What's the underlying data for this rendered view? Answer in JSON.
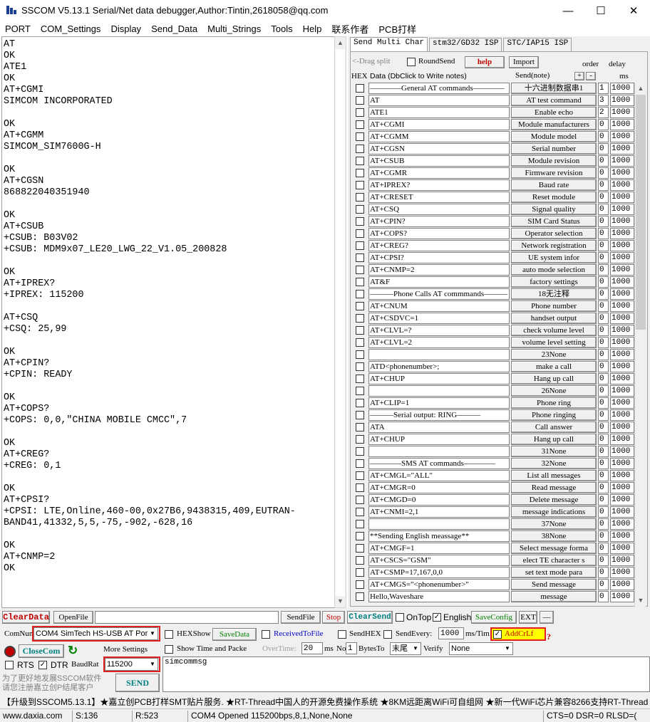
{
  "window": {
    "title": "SSCOM V5.13.1 Serial/Net data debugger,Author:Tintin,2618058@qq.com",
    "minimize": "—",
    "maximize": "☐",
    "close": "✕"
  },
  "menu": [
    "PORT",
    "COM_Settings",
    "Display",
    "Send_Data",
    "Multi_Strings",
    "Tools",
    "Help",
    "联系作者",
    "PCB打样"
  ],
  "receive_lines": [
    "AT",
    "OK",
    "ATE1",
    "OK",
    "AT+CGMI",
    "SIMCOM INCORPORATED",
    "",
    "OK",
    "AT+CGMM",
    "SIMCOM_SIM7600G-H",
    "",
    "OK",
    "AT+CGSN",
    "868822040351940",
    "",
    "OK",
    "AT+CSUB",
    "+CSUB: B03V02",
    "+CSUB: MDM9x07_LE20_LWG_22_V1.05_200828",
    "",
    "OK",
    "AT+IPREX?",
    "+IPREX: 115200",
    "",
    "AT+CSQ",
    "+CSQ: 25,99",
    "",
    "OK",
    "AT+CPIN?",
    "+CPIN: READY",
    "",
    "OK",
    "AT+COPS?",
    "+COPS: 0,0,\"CHINA MOBILE CMCC\",7",
    "",
    "OK",
    "AT+CREG?",
    "+CREG: 0,1",
    "",
    "OK",
    "AT+CPSI?",
    "+CPSI: LTE,Online,460-00,0x27B6,9438315,409,EUTRAN-",
    "BAND41,41332,5,5,-75,-902,-628,16",
    "",
    "OK",
    "AT+CNMP=2",
    "OK"
  ],
  "tabs": [
    "Send Multi Char",
    "stm32/GD32 ISP",
    "STC/IAP15 ISP"
  ],
  "multi": {
    "drag_split": "<-Drag split",
    "round_send": "RoundSend",
    "help": "help",
    "import": "Import",
    "order": "order",
    "delay": "delay",
    "hex": "HEX",
    "data_header": "Data (DbClick to Write notes)",
    "send_note": "Send(note)",
    "plus": "+",
    "minus": "-",
    "ms": "ms",
    "rows": [
      {
        "data": "————General AT commands————",
        "note": "十六进制数据串1",
        "order": "1",
        "delay": "1000"
      },
      {
        "data": "AT",
        "note": "AT test command",
        "order": "3",
        "delay": "1000"
      },
      {
        "data": "ATE1",
        "note": "Enable echo",
        "order": "2",
        "delay": "1000"
      },
      {
        "data": "AT+CGMI",
        "note": "Module manufacturers",
        "order": "0",
        "delay": "1000"
      },
      {
        "data": "AT+CGMM",
        "note": "Module model",
        "order": "0",
        "delay": "1000"
      },
      {
        "data": "AT+CGSN",
        "note": "Serial number",
        "order": "0",
        "delay": "1000"
      },
      {
        "data": "AT+CSUB",
        "note": "Module revision",
        "order": "0",
        "delay": "1000"
      },
      {
        "data": "AT+CGMR",
        "note": "Firmware revision",
        "order": "0",
        "delay": "1000"
      },
      {
        "data": "AT+IPREX?",
        "note": "Baud rate",
        "order": "0",
        "delay": "1000"
      },
      {
        "data": "AT+CRESET",
        "note": "Reset module",
        "order": "0",
        "delay": "1000"
      },
      {
        "data": "AT+CSQ",
        "note": "Signal quality",
        "order": "0",
        "delay": "1000"
      },
      {
        "data": "AT+CPIN?",
        "note": "SIM Card Status",
        "order": "0",
        "delay": "1000"
      },
      {
        "data": "AT+COPS?",
        "note": "Operator selection",
        "order": "0",
        "delay": "1000"
      },
      {
        "data": "AT+CREG?",
        "note": "Network registration",
        "order": "0",
        "delay": "1000"
      },
      {
        "data": "AT+CPSI?",
        "note": "UE system infor",
        "order": "0",
        "delay": "1000"
      },
      {
        "data": "AT+CNMP=2",
        "note": "auto mode selection",
        "order": "0",
        "delay": "1000"
      },
      {
        "data": "AT&F",
        "note": "factory settings",
        "order": "0",
        "delay": "1000"
      },
      {
        "data": "———Phone Calls AT commmands———",
        "note": "18无注释",
        "order": "0",
        "delay": "1000"
      },
      {
        "data": "AT+CNUM",
        "note": "Phone number",
        "order": "0",
        "delay": "1000"
      },
      {
        "data": "AT+CSDVC=1",
        "note": "handset output",
        "order": "0",
        "delay": "1000"
      },
      {
        "data": "AT+CLVL=?",
        "note": "check volume level",
        "order": "0",
        "delay": "1000"
      },
      {
        "data": "AT+CLVL=2",
        "note": "volume level setting",
        "order": "0",
        "delay": "1000"
      },
      {
        "data": "",
        "note": "23None",
        "order": "0",
        "delay": "1000"
      },
      {
        "data": "ATD<phonenumber>;",
        "note": "make a call",
        "order": "0",
        "delay": "1000"
      },
      {
        "data": "AT+CHUP",
        "note": "Hang up call",
        "order": "0",
        "delay": "1000"
      },
      {
        "data": "",
        "note": "26None",
        "order": "0",
        "delay": "1000"
      },
      {
        "data": "AT+CLIP=1",
        "note": "Phone ring",
        "order": "0",
        "delay": "1000"
      },
      {
        "data": "———Serial output: RING———",
        "note": "Phone ringing",
        "order": "0",
        "delay": "1000"
      },
      {
        "data": "ATA",
        "note": "Call answer",
        "order": "0",
        "delay": "1000"
      },
      {
        "data": "AT+CHUP",
        "note": "Hang up call",
        "order": "0",
        "delay": "1000"
      },
      {
        "data": "",
        "note": "31None",
        "order": "0",
        "delay": "1000"
      },
      {
        "data": "————SMS AT commands————",
        "note": "32None",
        "order": "0",
        "delay": "1000"
      },
      {
        "data": "AT+CMGL=\"ALL\"",
        "note": "List all messages",
        "order": "0",
        "delay": "1000"
      },
      {
        "data": "AT+CMGR=0",
        "note": "Read message",
        "order": "0",
        "delay": "1000"
      },
      {
        "data": "AT+CMGD=0",
        "note": "Delete message",
        "order": "0",
        "delay": "1000"
      },
      {
        "data": "AT+CNMI=2,1",
        "note": "message indications",
        "order": "0",
        "delay": "1000"
      },
      {
        "data": "",
        "note": "37None",
        "order": "0",
        "delay": "1000"
      },
      {
        "data": "**Sending English meassage**",
        "note": "38None",
        "order": "0",
        "delay": "1000"
      },
      {
        "data": "AT+CMGF=1",
        "note": "Select message forma",
        "order": "0",
        "delay": "1000"
      },
      {
        "data": "AT+CSCS=\"GSM\"",
        "note": "elect TE character s",
        "order": "0",
        "delay": "1000"
      },
      {
        "data": "AT+CSMP=17,167,0,0",
        "note": "set text mode para",
        "order": "0",
        "delay": "1000"
      },
      {
        "data": "AT+CMGS=\"<phonenumber>\"",
        "note": "Send message",
        "order": "0",
        "delay": "1000"
      },
      {
        "data": "Hello,Waveshare",
        "note": "message",
        "order": "0",
        "delay": "1000"
      }
    ]
  },
  "bottom": {
    "clear_data": "ClearData",
    "open_file": "OpenFile",
    "send_file": "SendFile",
    "stop": "Stop",
    "clear_send": "ClearSend",
    "on_top": "OnTop",
    "english": "English",
    "save_config": "SaveConfig",
    "ext": "EXT",
    "dash": "—",
    "com_num_label": "ComNum",
    "com_port": "COM4 SimTech HS-USB AT Por",
    "hex_show": "HEXShow",
    "save_data": "SaveData",
    "received_to_file": "ReceivedToFile",
    "send_hex": "SendHEX",
    "send_every": "SendEvery:",
    "send_every_value": "1000",
    "ms_tim": "ms/Tim",
    "add_crlf": "AddCrLf",
    "close_com": "CloseCom",
    "more_settings": "More Settings",
    "show_time": "Show Time and Packe",
    "overtime": "OverTime:",
    "overtime_value": "20",
    "ms": "ms",
    "no": "No",
    "no_value": "1",
    "bytes_to": "BytesTo",
    "bytes_end": "末尾",
    "verify": "Verify",
    "verify_value": "None",
    "rts": "RTS",
    "dtr": "DTR",
    "baud_label": "BaudRat",
    "baud_value": "115200",
    "send_text": "simcommsg",
    "promo": "为了更好地发展SSCOM软件\n请您注册嘉立创P结尾客户",
    "send": "SEND",
    "question": "?"
  },
  "ad": "【升级到SSCOM5.13.1】★嘉立创PCB打样SMT贴片服务. ★RT-Thread中国人的开源免费操作系统 ★8KM远距离WiFi可自组网 ★新一代WiFi芯片兼容8266支持RT-Thread",
  "status": {
    "site": "www.daxia.com",
    "sent": "S:136",
    "received": "R:523",
    "port_state": "COM4 Opened  115200bps,8,1,None,None",
    "lines": "CTS=0 DSR=0 RLSD=("
  },
  "colors": {
    "clear_data": "#c00000",
    "stop": "#c00000",
    "clear_send": "#008080",
    "save": "#008000",
    "highlight": "#ffff00",
    "red_box": "#e02020"
  }
}
